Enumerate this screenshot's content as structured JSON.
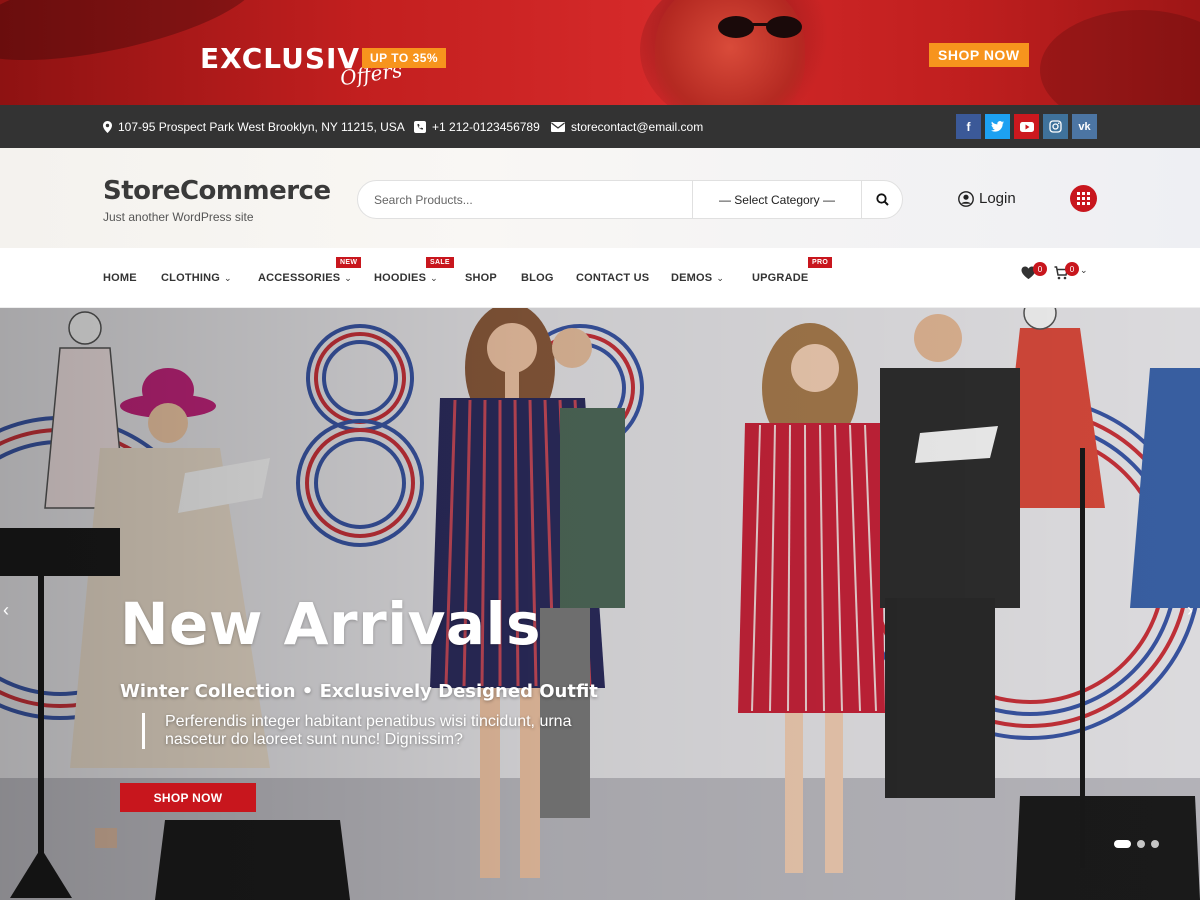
{
  "promo": {
    "headline": "EXCLUSIVE",
    "script_word": "Offers",
    "badge": "UP TO 35%",
    "cta": "SHOP NOW"
  },
  "topbar": {
    "address": "107-95 Prospect Park West Brooklyn, NY 11215, USA",
    "phone": "+1 212-0123456789",
    "email": "storecontact@email.com",
    "socials": [
      {
        "name": "facebook-icon",
        "glyph": "f",
        "color": "#3b5998"
      },
      {
        "name": "twitter-icon",
        "glyph": "🐦",
        "color": "#1da1f2"
      },
      {
        "name": "youtube-icon",
        "glyph": "▶",
        "color": "#cc181e"
      },
      {
        "name": "instagram-icon",
        "glyph": "◎",
        "color": "#3f729b"
      },
      {
        "name": "vk-icon",
        "glyph": "vk",
        "color": "#4c75a3"
      }
    ]
  },
  "header": {
    "site_title": "StoreCommerce",
    "tagline": "Just another WordPress site",
    "search_placeholder": "Search Products...",
    "category_select": "— Select Category —",
    "login": "Login"
  },
  "nav": {
    "items": [
      {
        "label": "HOME",
        "dropdown": false,
        "badge": ""
      },
      {
        "label": "CLOTHING",
        "dropdown": true,
        "badge": ""
      },
      {
        "label": "ACCESSORIES",
        "dropdown": true,
        "badge": "NEW"
      },
      {
        "label": "HOODIES",
        "dropdown": true,
        "badge": "SALE"
      },
      {
        "label": "SHOP",
        "dropdown": false,
        "badge": ""
      },
      {
        "label": "BLOG",
        "dropdown": false,
        "badge": ""
      },
      {
        "label": "CONTACT US",
        "dropdown": false,
        "badge": ""
      },
      {
        "label": "DEMOS",
        "dropdown": true,
        "badge": ""
      },
      {
        "label": "UPGRADE",
        "dropdown": false,
        "badge": "PRO"
      }
    ],
    "wishlist_count": "0",
    "cart_count": "0"
  },
  "hero": {
    "title": "New Arrivals",
    "subtitle": "Winter Collection • Exclusively Designed Outfit",
    "description": "Perferendis integer habitant penatibus wisi tincidunt, urna nascetur do laoreet sunt nunc! Dignissim?",
    "cta": "SHOP NOW",
    "slide_count": 3,
    "active_slide": 1
  },
  "colors": {
    "accent": "#c8161d",
    "promo_orange": "#f7941d",
    "topbar_bg": "#333333"
  }
}
